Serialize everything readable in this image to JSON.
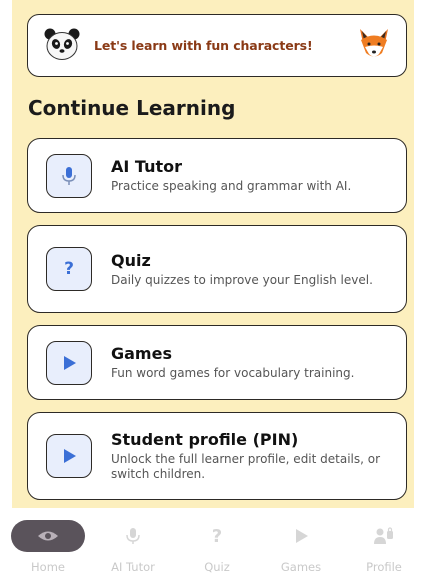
{
  "banner": {
    "text": "Let's learn with fun characters!",
    "left_icon": "panda-icon",
    "right_icon": "fox-icon"
  },
  "section": {
    "title": "Continue Learning"
  },
  "cards": [
    {
      "icon": "microphone-icon",
      "title": "AI Tutor",
      "subtitle": "Practice speaking and grammar with AI."
    },
    {
      "icon": "question-mark-icon",
      "title": "Quiz",
      "subtitle": "Daily quizzes to improve your English level."
    },
    {
      "icon": "play-icon",
      "title": "Games",
      "subtitle": "Fun word games for vocabulary training."
    },
    {
      "icon": "play-icon",
      "title": "Student profile (PIN)",
      "subtitle": "Unlock the full learner profile, edit details, or switch children."
    }
  ],
  "nav": {
    "active": "Home",
    "items": [
      {
        "label": "Home",
        "icon": "eye-icon"
      },
      {
        "label": "AI Tutor",
        "icon": "microphone-icon"
      },
      {
        "label": "Quiz",
        "icon": "question-mark-icon"
      },
      {
        "label": "Games",
        "icon": "play-icon"
      },
      {
        "label": "Profile",
        "icon": "profile-icon"
      }
    ]
  },
  "colors": {
    "background": "#fcefbe",
    "accent": "#3b6fd6",
    "banner_text": "#8a3a16",
    "nav_active": "#5a535b"
  }
}
